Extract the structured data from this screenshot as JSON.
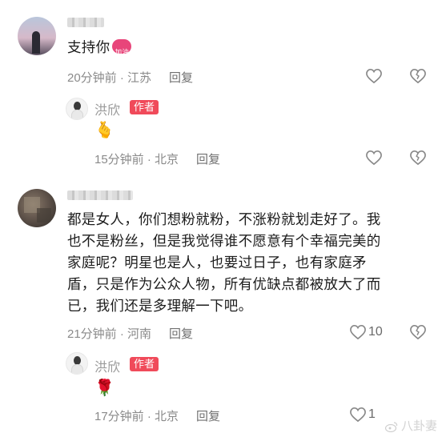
{
  "comments": [
    {
      "text": "支持你",
      "emoji_badge": "加油",
      "time": "20分钟前",
      "location": "江苏",
      "reply_label": "回复",
      "replies": [
        {
          "username": "洪欣",
          "badge": "作者",
          "emoji": "🫰",
          "time": "15分钟前",
          "location": "北京",
          "reply_label": "回复"
        }
      ]
    },
    {
      "text_lines": [
        "都是女人，你们想粉就粉，不涨粉就划走好了。我",
        "也不是粉丝，但是我觉得谁不愿意有个幸福完美的",
        "家庭呢？明星也是人，也要过日子，也有家庭矛",
        "盾，只是作为公众人物，所有优缺点都被放大了而",
        "已，我们还是多理解一下吧。"
      ],
      "time": "21分钟前",
      "location": "河南",
      "reply_label": "回复",
      "like_count": "10",
      "replies": [
        {
          "username": "洪欣",
          "badge": "作者",
          "emoji": "🌹",
          "time": "17分钟前",
          "location": "北京",
          "reply_label": "回复",
          "like_count": "1"
        }
      ]
    }
  ],
  "meta_separator": " · ",
  "watermark": "八卦妻",
  "icons": {
    "like": "heart-outline-icon",
    "dislike": "broken-heart-icon"
  }
}
